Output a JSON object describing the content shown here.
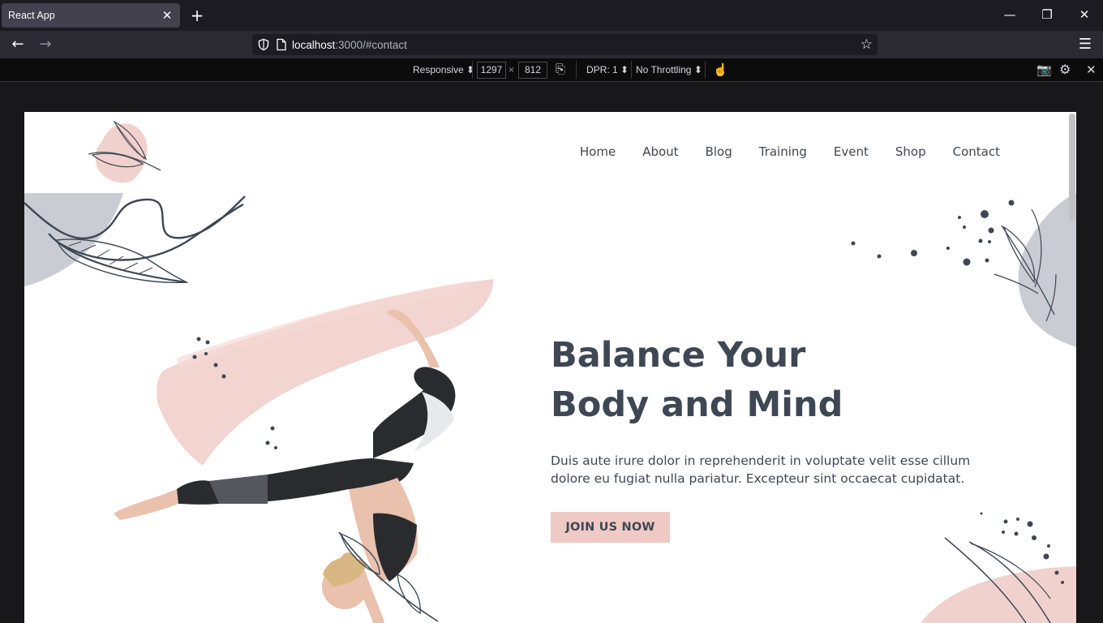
{
  "browser": {
    "tab_title": "React App",
    "url_host": "localhost",
    "url_path": ":3000/#contact"
  },
  "rdm": {
    "device": "Responsive",
    "width": "1297",
    "times": "×",
    "height": "812",
    "dpr": "DPR: 1",
    "throttling": "No Throttling"
  },
  "site": {
    "menu": [
      "Home",
      "About",
      "Blog",
      "Training",
      "Event",
      "Shop",
      "Contact"
    ],
    "hero": {
      "title_line1": "Balance Your",
      "title_line2": "Body and Mind",
      "text_line1": "Duis aute irure dolor in reprehenderit in voluptate velit esse cillum",
      "text_line2": "dolore eu fugiat nulla pariatur. Excepteur sint occaecat cupidatat.",
      "cta": "JOIN US NOW"
    },
    "colors": {
      "text": "#3e4753",
      "accent": "#efc9c4",
      "gray_blob": "#c9ccd2"
    }
  }
}
